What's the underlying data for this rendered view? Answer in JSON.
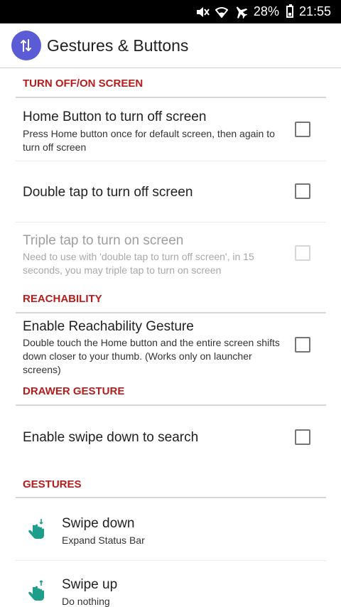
{
  "status_bar": {
    "battery_percent": "28%",
    "time": "21:55"
  },
  "app_bar": {
    "title": "Gestures & Buttons"
  },
  "sections": {
    "turn_off_on": "TURN OFF/ON SCREEN",
    "reachability": "REACHABILITY",
    "drawer_gesture": "DRAWER GESTURE",
    "gestures": "GESTURES"
  },
  "prefs": {
    "home_button": {
      "title": "Home Button to turn off screen",
      "summary": "Press Home button once for default screen, then again to turn off screen",
      "checked": false
    },
    "double_tap": {
      "title": "Double tap to turn off screen",
      "checked": false
    },
    "triple_tap": {
      "title": "Triple tap to turn on screen",
      "summary": "Need to use with 'double tap to turn off screen', in 15 seconds, you may triple tap to turn on screen",
      "checked": false,
      "enabled": false
    },
    "reachability": {
      "title": "Enable Reachability Gesture",
      "summary": "Double touch the Home button and the entire screen shifts down closer to your thumb. (Works only on launcher screens)",
      "checked": false
    },
    "swipe_search": {
      "title": "Enable swipe down to search",
      "checked": false
    }
  },
  "gestures": [
    {
      "title": "Swipe down",
      "subtitle": "Expand Status Bar",
      "icon": "hand-swipe-down-icon"
    },
    {
      "title": "Swipe up",
      "subtitle": "Do nothing",
      "icon": "hand-swipe-up-icon"
    }
  ],
  "colors": {
    "section_header": "#b71c1c",
    "app_icon": "#5b5bd6",
    "gesture_icon": "#1e9e8a"
  }
}
